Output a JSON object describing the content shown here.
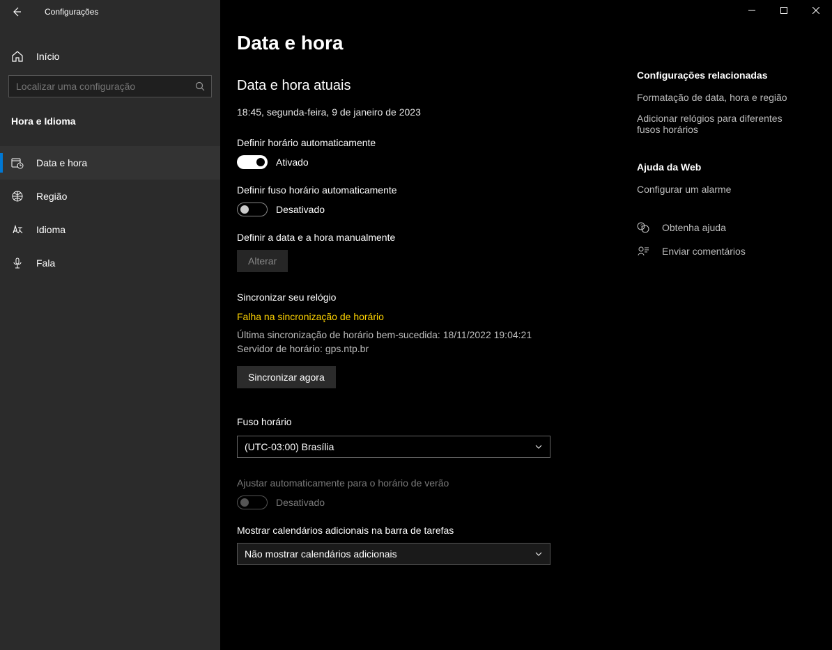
{
  "window": {
    "app_title": "Configurações"
  },
  "sidebar": {
    "home_label": "Início",
    "search_placeholder": "Localizar uma configuração",
    "category": "Hora e Idioma",
    "items": [
      {
        "label": "Data e hora"
      },
      {
        "label": "Região"
      },
      {
        "label": "Idioma"
      },
      {
        "label": "Fala"
      }
    ]
  },
  "main": {
    "page_title": "Data e hora",
    "current_heading": "Data e hora atuais",
    "current_value": "18:45, segunda-feira, 9 de janeiro de 2023",
    "auto_time_label": "Definir horário automaticamente",
    "auto_time_state": "Ativado",
    "auto_tz_label": "Definir fuso horário automaticamente",
    "auto_tz_state": "Desativado",
    "manual_label": "Definir a data e a hora manualmente",
    "change_btn": "Alterar",
    "sync_heading": "Sincronizar seu relógio",
    "sync_error": "Falha na sincronização de horário",
    "sync_last": "Última sincronização de horário bem-sucedida: 18/11/2022 19:04:21",
    "sync_server": "Servidor de horário: gps.ntp.br",
    "sync_btn": "Sincronizar agora",
    "tz_heading": "Fuso horário",
    "tz_value": "(UTC-03:00) Brasília",
    "dst_label": "Ajustar automaticamente para o horário de verão",
    "dst_state": "Desativado",
    "calendars_label": "Mostrar calendários adicionais na barra de tarefas",
    "calendars_value": "Não mostrar calendários adicionais"
  },
  "right": {
    "related_heading": "Configurações relacionadas",
    "related_links": [
      "Formatação de data, hora e região",
      "Adicionar relógios para diferentes fusos horários"
    ],
    "webhelp_heading": "Ajuda da Web",
    "webhelp_links": [
      "Configurar um alarme"
    ],
    "get_help": "Obtenha ajuda",
    "feedback": "Enviar comentários"
  }
}
